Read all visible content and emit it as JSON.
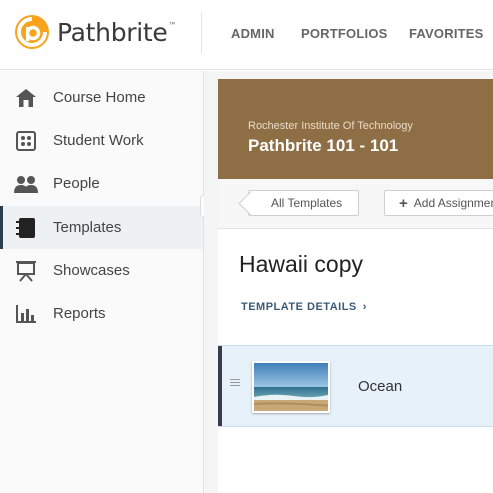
{
  "header": {
    "logo_text": "Pathbrite",
    "logo_tm": "™",
    "nav": [
      "ADMIN",
      "PORTFOLIOS",
      "FAVORITES"
    ]
  },
  "sidebar": {
    "items": [
      {
        "label": "Course Home",
        "icon": "home-icon"
      },
      {
        "label": "Student Work",
        "icon": "student-work-icon"
      },
      {
        "label": "People",
        "icon": "people-icon"
      },
      {
        "label": "Templates",
        "icon": "templates-icon",
        "active": true
      },
      {
        "label": "Showcases",
        "icon": "showcase-icon"
      },
      {
        "label": "Reports",
        "icon": "reports-icon"
      }
    ]
  },
  "course": {
    "institution": "Rochester Institute Of Technology",
    "title": "Pathbrite 101 - 101"
  },
  "toolbar": {
    "back_label": "All Templates",
    "add_label": "Add Assignment"
  },
  "template": {
    "title": "Hawaii copy",
    "details_label": "TEMPLATE DETAILS",
    "details_chevron": "›",
    "items": [
      {
        "label": "Ocean",
        "thumbnail": "ocean-beach-photo"
      }
    ]
  },
  "colors": {
    "brand_orange": "#f7a31c",
    "banner_brown": "#8d6e45",
    "link_blue": "#3a5a78",
    "row_highlight": "#e7f1fa"
  }
}
